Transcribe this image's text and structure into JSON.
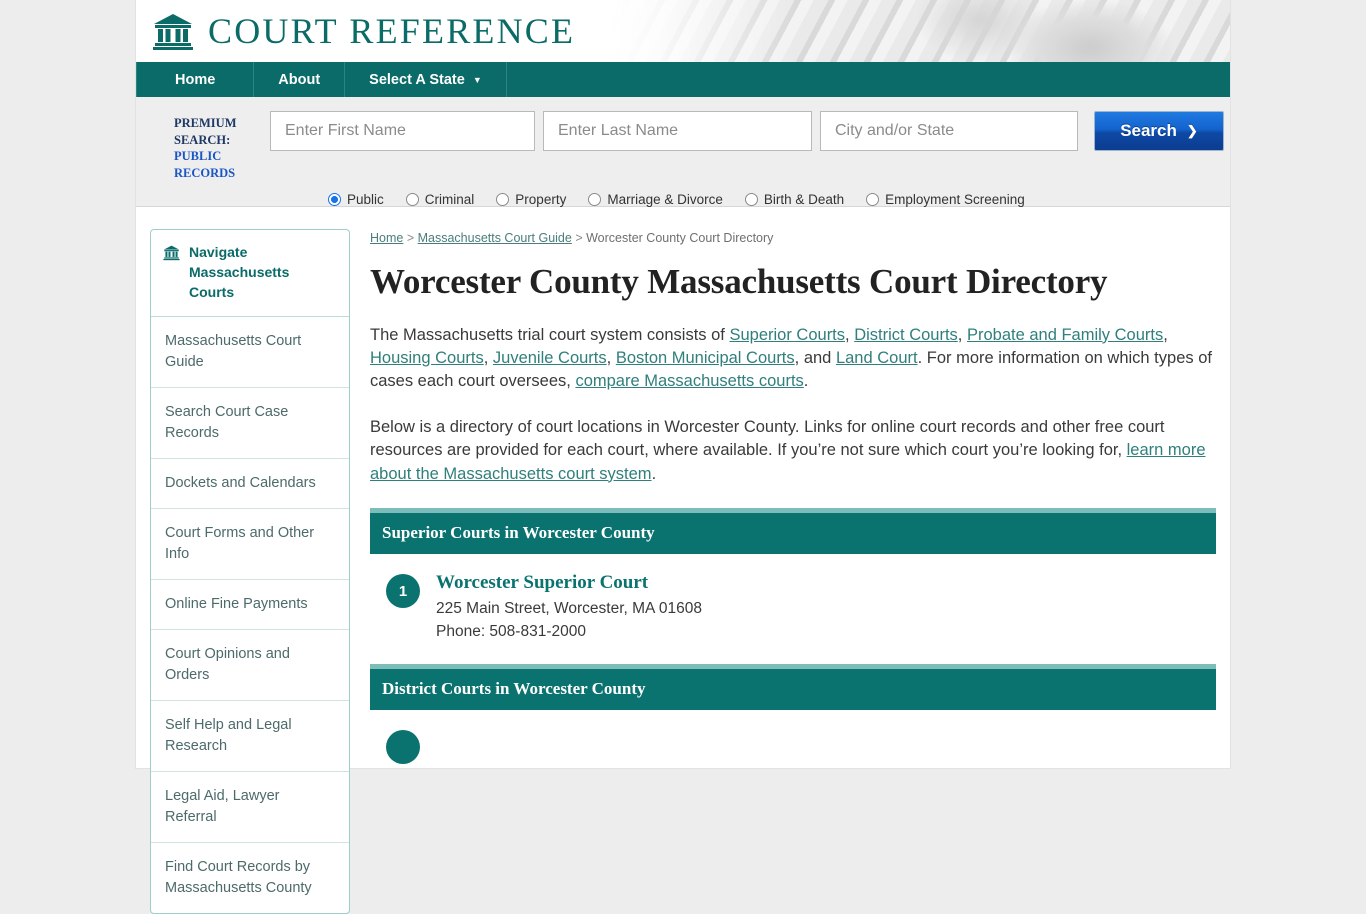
{
  "site": {
    "brand": "COURT REFERENCE",
    "logo_icon": "courthouse-icon",
    "teal": "#0a6b69",
    "accent_blue": "#1463cf"
  },
  "nav": {
    "items": [
      {
        "label": "Home"
      },
      {
        "label": "About"
      },
      {
        "label": "Select A State",
        "caret": "▼"
      }
    ]
  },
  "premium_search": {
    "label_line1": "PREMIUM",
    "label_line2": "SEARCH:",
    "label_line3": "PUBLIC",
    "label_line4": "RECORDS",
    "first_name": {
      "placeholder": "Enter First Name",
      "value": ""
    },
    "last_name": {
      "placeholder": "Enter Last Name",
      "value": ""
    },
    "city_state": {
      "placeholder": "City and/or State",
      "value": ""
    },
    "search_button": "Search",
    "search_button_chevron": "❯",
    "radios": [
      {
        "label": "Public",
        "selected": true
      },
      {
        "label": "Criminal",
        "selected": false
      },
      {
        "label": "Property",
        "selected": false
      },
      {
        "label": "Marriage & Divorce",
        "selected": false
      },
      {
        "label": "Birth & Death",
        "selected": false
      },
      {
        "label": "Employment Screening",
        "selected": false
      }
    ]
  },
  "sidebar": {
    "header_icon": "courthouse-icon",
    "header_line1": "Navigate",
    "header_line2": "Massachusetts Courts",
    "items": [
      {
        "label": "Massachusetts Court Guide"
      },
      {
        "label": "Search Court Case Records"
      },
      {
        "label": "Dockets and Calendars"
      },
      {
        "label": "Court Forms and Other Info"
      },
      {
        "label": "Online Fine Payments"
      },
      {
        "label": "Court Opinions and Orders"
      },
      {
        "label": "Self Help and Legal Research"
      },
      {
        "label": "Legal Aid, Lawyer Referral"
      },
      {
        "label": "Find Court Records by Massachusetts County"
      }
    ]
  },
  "breadcrumb": {
    "home": "Home",
    "sep1": " > ",
    "guide": "Massachusetts Court Guide",
    "sep2": " > ",
    "current": "Worcester County Court Directory"
  },
  "page": {
    "title": "Worcester County Massachusetts Court Directory",
    "intro": {
      "t1": "The Massachusetts trial court system consists of ",
      "l1": "Superior Courts",
      "t2": ", ",
      "l2": "District Courts",
      "t3": ", ",
      "l3": "Probate and Family Courts",
      "t4": ", ",
      "l4": "Housing Courts",
      "t5": ", ",
      "l5": "Juvenile Courts",
      "t6": ", ",
      "l6": "Boston Municipal Courts",
      "t7": ", and ",
      "l7": "Land Court",
      "t8": ". For more information on which types of cases each court oversees, ",
      "l8": "compare Massachusetts courts",
      "t9": "."
    },
    "directory_note": {
      "t1": "Below is a directory of court locations in Worcester County. Links for online court records and other free court resources are provided for each court, where available. If you’re not sure which court you’re looking for, ",
      "l1": "learn more about the Massachusetts court system",
      "t2": "."
    }
  },
  "sections": [
    {
      "heading": "Superior Courts in Worcester County",
      "courts": [
        {
          "num": "1",
          "name": "Worcester Superior Court",
          "address": "225 Main Street, Worcester, MA 01608",
          "phone": "Phone: 508-831-2000"
        }
      ]
    },
    {
      "heading": "District Courts in Worcester County",
      "courts": []
    }
  ]
}
